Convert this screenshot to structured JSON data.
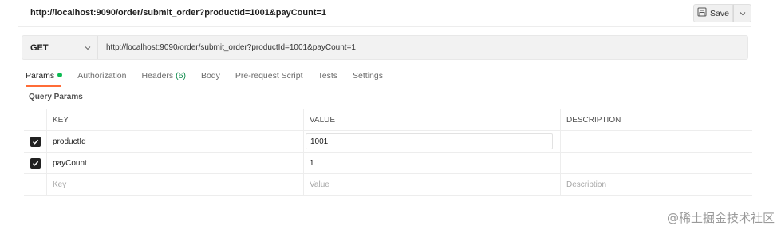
{
  "request": {
    "title": "http://localhost:9090/order/submit_order?productId=1001&payCount=1",
    "method": "GET",
    "url": "http://localhost:9090/order/submit_order?productId=1001&payCount=1",
    "save_label": "Save"
  },
  "tabs": [
    {
      "label": "Params"
    },
    {
      "label": "Authorization"
    },
    {
      "label": "Headers",
      "count": "(6)"
    },
    {
      "label": "Body"
    },
    {
      "label": "Pre-request Script"
    },
    {
      "label": "Tests"
    },
    {
      "label": "Settings"
    }
  ],
  "params": {
    "section_label": "Query Params",
    "columns": {
      "key": "KEY",
      "value": "VALUE",
      "description": "DESCRIPTION"
    },
    "rows": [
      {
        "key": "productId",
        "value": "1001",
        "description": "",
        "checked": true
      },
      {
        "key": "payCount",
        "value": "1",
        "description": "",
        "checked": true
      }
    ],
    "placeholder": {
      "key": "Key",
      "value": "Value",
      "description": "Description"
    }
  },
  "watermark": "@稀土掘金技术社区",
  "colors": {
    "accent": "#ff6c37",
    "status_dot": "#0cbb52",
    "headers_count": "#0c8a4a"
  }
}
